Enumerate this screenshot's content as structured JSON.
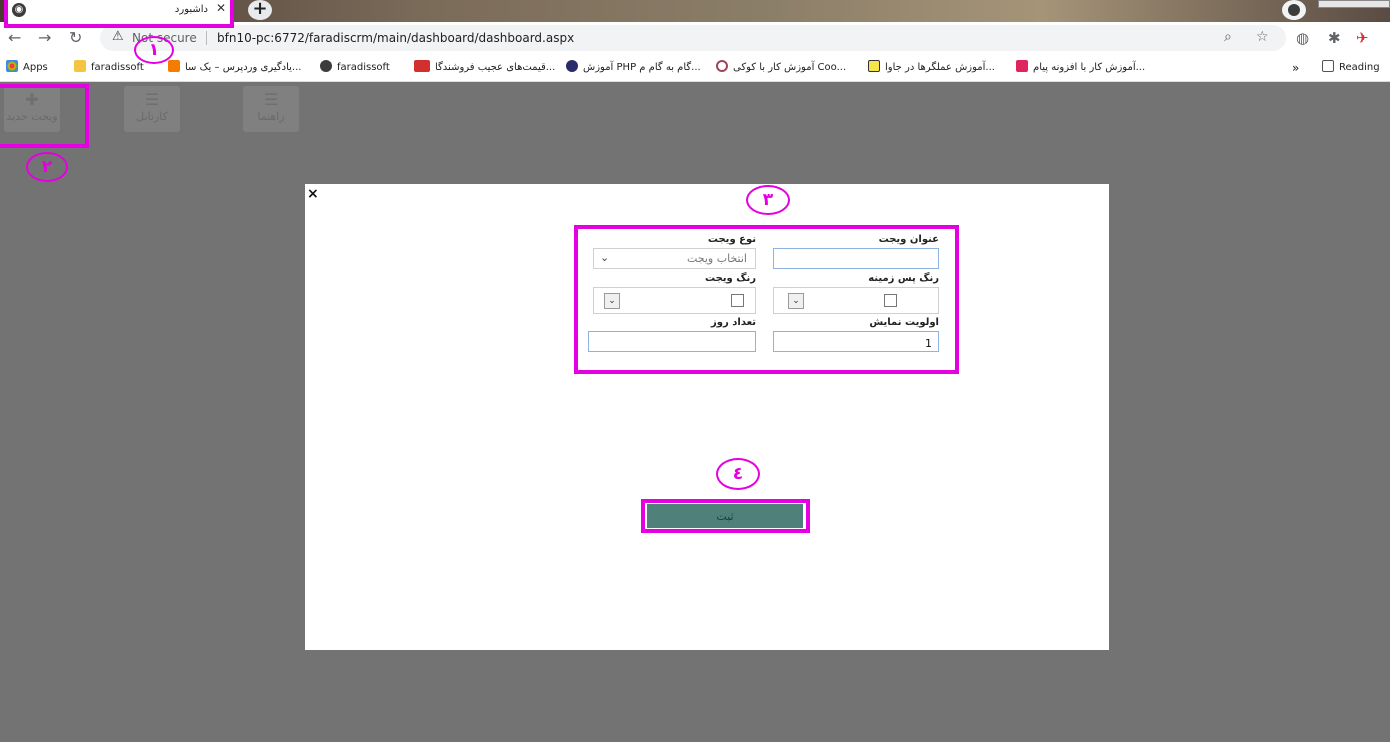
{
  "browser": {
    "tab_title": "داشبورد",
    "tab_close": "✕",
    "new_tab": "+",
    "security_text": "Not secure",
    "url": "bfn10-pc:6772/faradiscrm/main/dashboard/dashboard.aspx"
  },
  "bookmarks": {
    "apps": "Apps",
    "items": [
      "faradissoft",
      "یادگیری وردپرس – یک سا...",
      "faradissoft",
      "قیمت‌های عجیب فروشندگا...",
      "آموزش PHP گام به گام م...",
      "آموزش کار با کوکی Coo...",
      "آموزش عملگرها در جاوا...",
      "آموزش کار با افزونه پیام..."
    ],
    "overflow": "»",
    "reading_list": "Reading"
  },
  "toolbar": {
    "new_widget": "ویجت جدید",
    "kartabl": "کارتابل",
    "help": "راهنما"
  },
  "annotations": [
    "١",
    "٢",
    "٣",
    "٤"
  ],
  "modal": {
    "close": "×",
    "fields": {
      "widget_title_label": "عنوان ویجت",
      "widget_title_value": "",
      "widget_type_label": "نوع ویجت",
      "widget_type_selected": "انتخاب ویجت",
      "bg_color_label": "رنگ پس زمینه",
      "widget_color_label": "رنگ ویجت",
      "priority_label": "اولویت نمایش",
      "priority_value": "1",
      "days_label": "تعداد روز",
      "days_value": ""
    },
    "submit": "ثبت"
  },
  "colors": {
    "highlight": "#e400e0",
    "submit_bg": "#4f8079",
    "overlay": "#737373"
  }
}
